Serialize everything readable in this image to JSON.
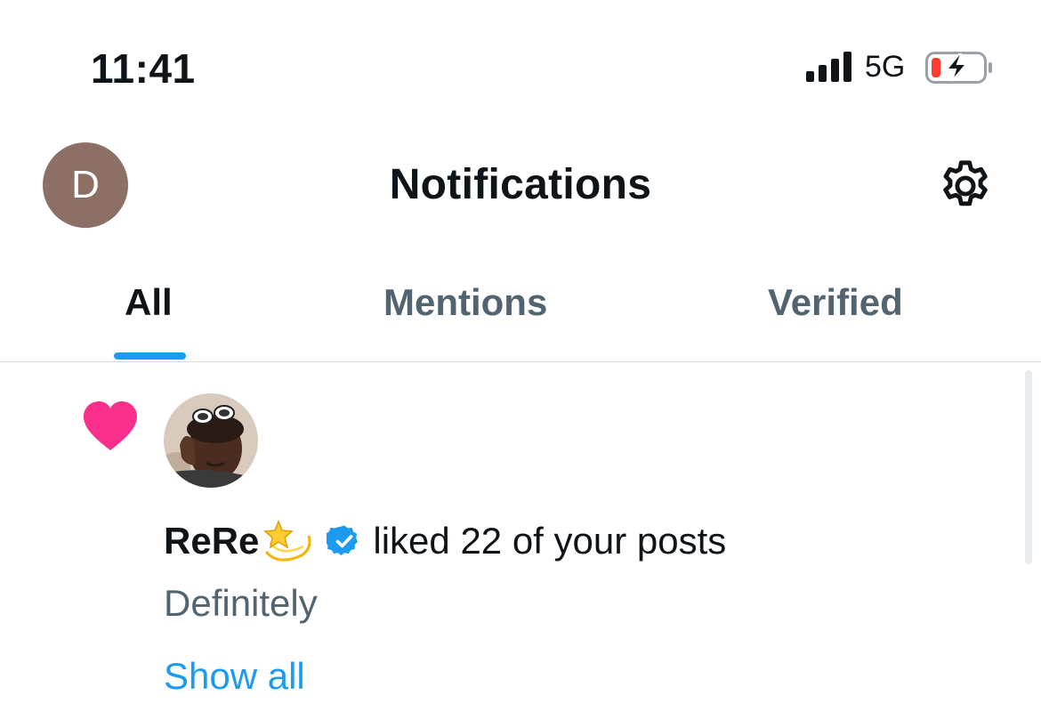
{
  "status_bar": {
    "time": "11:41",
    "network": "5G",
    "icons": [
      "signal-bars-icon",
      "battery-charging-icon"
    ],
    "battery_level": 0.15
  },
  "header": {
    "avatar_initial": "D",
    "title": "Notifications",
    "settings_icon": "gear-icon"
  },
  "tabs": [
    {
      "label": "All",
      "active": true
    },
    {
      "label": "Mentions",
      "active": false
    },
    {
      "label": "Verified",
      "active": false
    }
  ],
  "notification": {
    "type_icon": "heart-icon",
    "actor_name": "ReRe",
    "actor_emoji": "dizzy-star-emoji",
    "verified_icon": "verified-badge-icon",
    "action": "liked 22 of your posts",
    "preview": "Definitely",
    "show_all": "Show all"
  },
  "colors": {
    "accent": "#1d9bf0",
    "heart": "#f91880",
    "secondary_text": "#536471",
    "avatar_bg": "#8c7065"
  }
}
